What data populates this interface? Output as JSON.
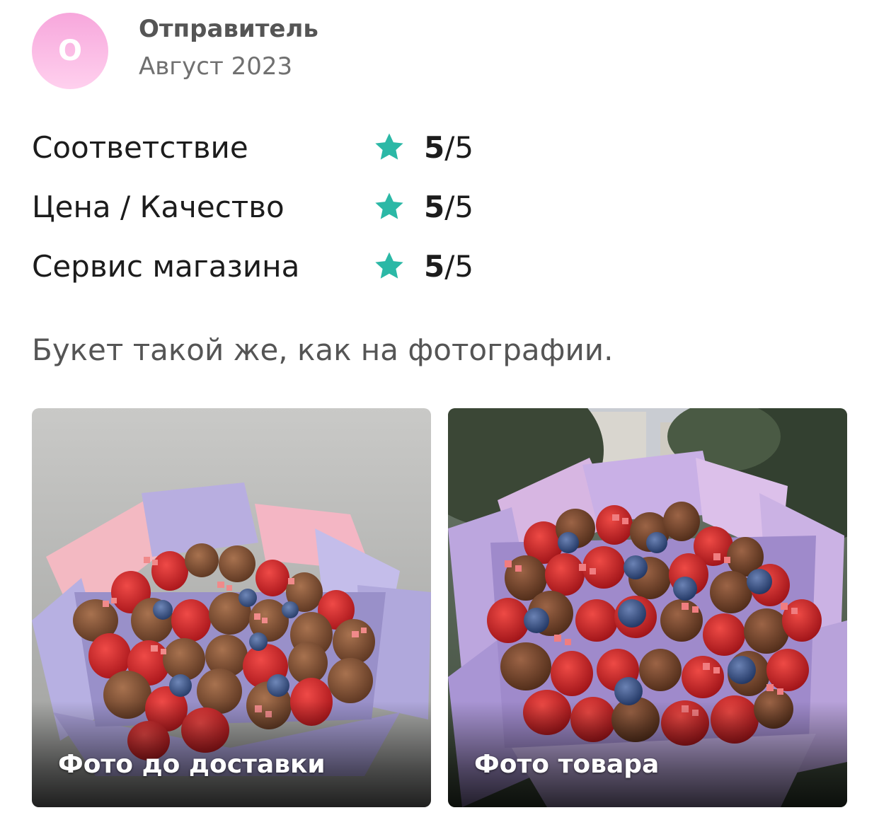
{
  "review": {
    "avatar_letter": "О",
    "sender": "Отправитель",
    "date": "Август 2023",
    "ratings": [
      {
        "label": "Соответствие",
        "score": "5",
        "max": "/5"
      },
      {
        "label": "Цена / Качество",
        "score": "5",
        "max": "/5"
      },
      {
        "label": "Сервис магазина",
        "score": "5",
        "max": "/5"
      }
    ],
    "text": "Букет такой же, как на фотографии.",
    "photos": [
      {
        "caption": "Фото до доставки"
      },
      {
        "caption": "Фото товара"
      }
    ]
  },
  "colors": {
    "star": "#2bb8a6",
    "avatar_gradient_top": "#f7a7dc",
    "avatar_gradient_bottom": "#ffd0ee"
  },
  "icons": {
    "rating": "star-icon"
  }
}
